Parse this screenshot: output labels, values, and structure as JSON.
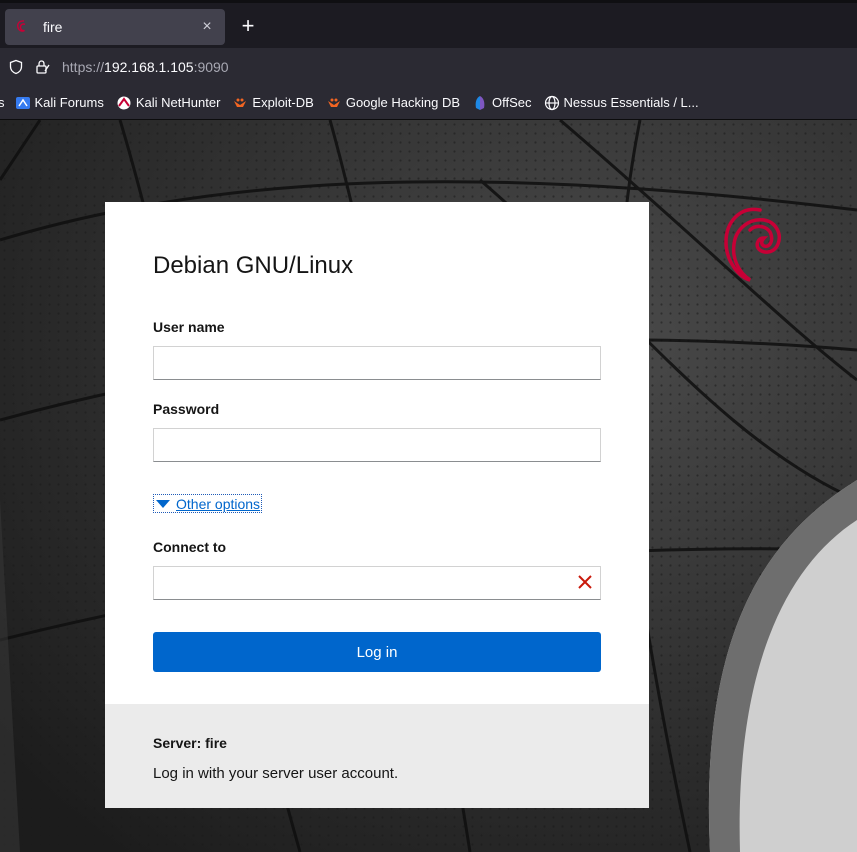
{
  "browser": {
    "tab": {
      "title": "fire",
      "close": "×"
    },
    "new_tab": "+",
    "url": {
      "scheme": "https://",
      "host": "192.168.1.105",
      "port": ":9090"
    },
    "bookmarks": {
      "cut_prefix": "s",
      "items": [
        {
          "label": "Kali Forums",
          "icon": "kali-icon"
        },
        {
          "label": "Kali NetHunter",
          "icon": "nethunter-icon"
        },
        {
          "label": "Exploit-DB",
          "icon": "exploitdb-icon"
        },
        {
          "label": "Google Hacking DB",
          "icon": "ghdb-icon"
        },
        {
          "label": "OffSec",
          "icon": "offsec-icon"
        },
        {
          "label": "Nessus Essentials / L...",
          "icon": "globe-icon"
        }
      ]
    }
  },
  "login": {
    "title": "Debian GNU/Linux",
    "username_label": "User name",
    "username_value": "",
    "password_label": "Password",
    "password_value": "",
    "other_options": "Other options",
    "connect_label": "Connect to",
    "connect_value": "",
    "login_button": "Log in",
    "server": "Server: fire",
    "help": "Log in with your server user account."
  },
  "colors": {
    "accent": "#0066cc",
    "debian_red": "#c70036",
    "clear_red": "#c9190b"
  }
}
